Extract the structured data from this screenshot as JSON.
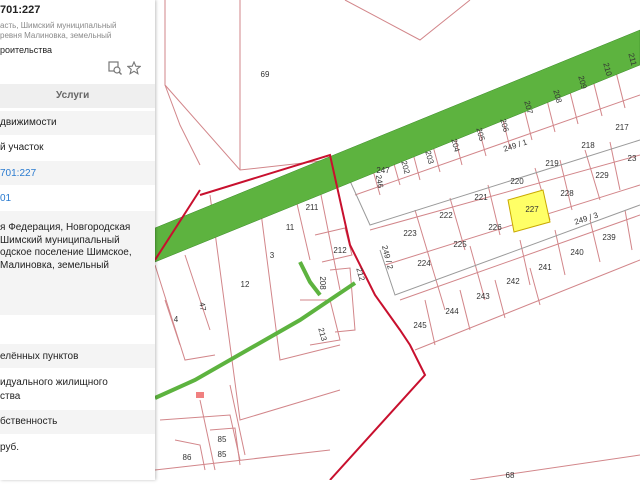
{
  "panel": {
    "title": "701:227",
    "subtitle_lines": [
      "асть, Шимский муниципальный",
      "ревня Малиновка, земельный"
    ],
    "purpose": "роительства",
    "services_label": "Услуги",
    "rows": [
      "движимости",
      "й участок",
      "701:227",
      "01",
      "елённых пунктов",
      "идуального жилищного",
      "ства",
      "бственность",
      "руб."
    ],
    "address_lines": [
      "я Федерация, Новгородская",
      "Шимский муниципальный",
      "одское поселение Шимское,",
      "Малиновка, земельный"
    ]
  },
  "map": {
    "colors": {
      "road": "#5db33f",
      "boundary": "#c8102e",
      "line": "#d2868a",
      "selected": "#ffff66",
      "gray": "#9a9a9a"
    },
    "labels": [
      "69",
      "211",
      "11",
      "212",
      "3",
      "208",
      "212",
      "213",
      "12",
      "47",
      "4",
      "85",
      "86",
      "85",
      "246",
      "247",
      "202",
      "203",
      "204",
      "205",
      "206",
      "207",
      "208",
      "209",
      "210",
      "211",
      "217",
      "249 / 1",
      "219",
      "218",
      "23",
      "220",
      "221",
      "228",
      "229",
      "222",
      "223",
      "226",
      "227",
      "249 / 3",
      "225",
      "224",
      "249 / 2",
      "240",
      "239",
      "241",
      "242",
      "243",
      "244",
      "245",
      "68"
    ]
  }
}
